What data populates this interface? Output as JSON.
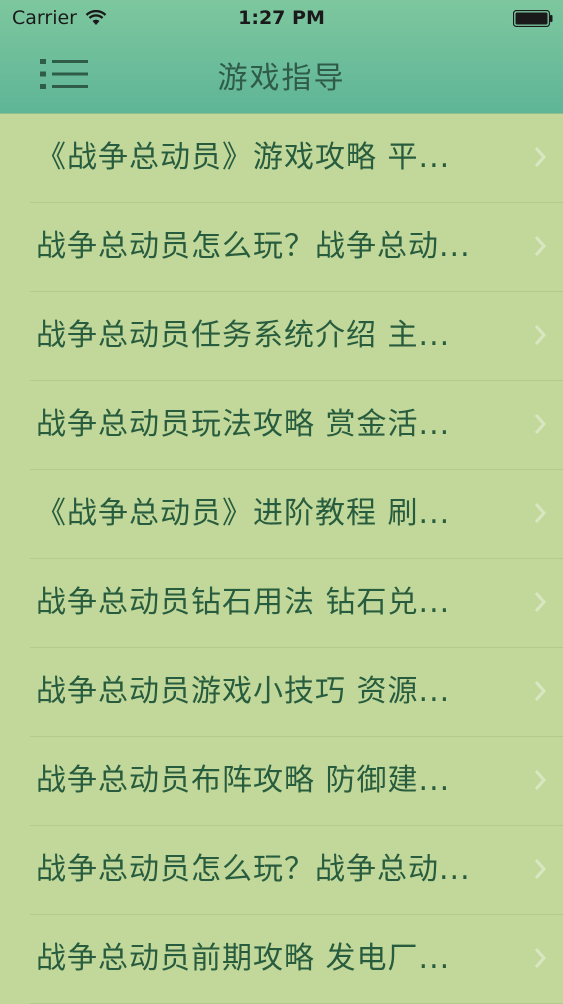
{
  "status": {
    "carrier": "Carrier",
    "time": "1:27 PM"
  },
  "nav": {
    "title": "游戏指导",
    "menu_icon": "menu-icon"
  },
  "items": [
    {
      "label": "《战争总动员》游戏攻略 平..."
    },
    {
      "label": "战争总动员怎么玩？战争总动..."
    },
    {
      "label": "战争总动员任务系统介绍 主..."
    },
    {
      "label": "战争总动员玩法攻略 赏金活..."
    },
    {
      "label": "《战争总动员》进阶教程 刷..."
    },
    {
      "label": "战争总动员钻石用法 钻石兑..."
    },
    {
      "label": "战争总动员游戏小技巧 资源..."
    },
    {
      "label": "战争总动员布阵攻略 防御建..."
    },
    {
      "label": "战争总动员怎么玩？战争总动..."
    },
    {
      "label": "战争总动员前期攻略 发电厂..."
    }
  ],
  "colors": {
    "header": "#5eb597",
    "background": "#c2d89a",
    "text": "#285c3e"
  }
}
